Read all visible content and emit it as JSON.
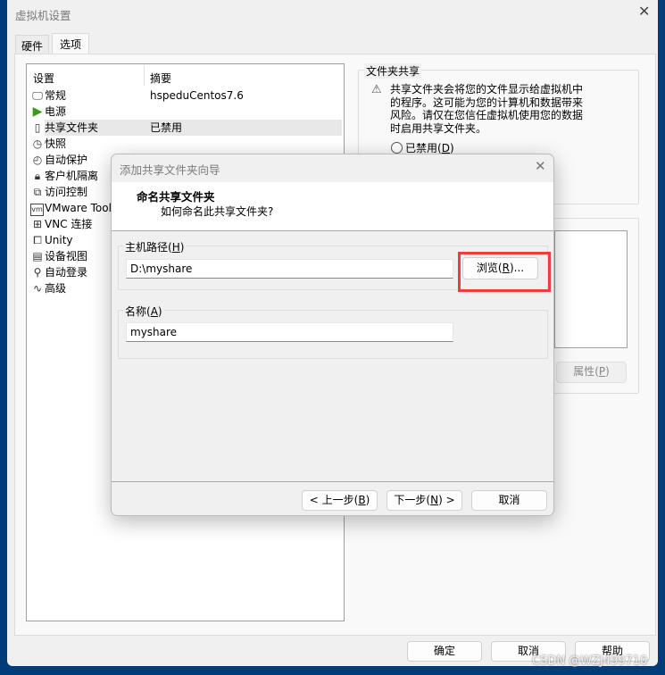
{
  "window": {
    "title": "虚拟机设置",
    "close_icon": "close-icon"
  },
  "tabs": [
    {
      "label": "硬件"
    },
    {
      "label": "选项",
      "selected": true
    }
  ],
  "settings_list": {
    "headers": [
      "设置",
      "摘要"
    ],
    "items": [
      {
        "icon": "monitor-icon",
        "glyph": "🖵",
        "label": "常规",
        "summary": "hspeduCentos7.6"
      },
      {
        "icon": "power-play-icon",
        "glyph": "▶",
        "label": "电源",
        "summary": ""
      },
      {
        "icon": "shared-folder-icon",
        "glyph": "▯",
        "label": "共享文件夹",
        "summary": "已禁用",
        "selected": true
      },
      {
        "icon": "snapshot-icon",
        "glyph": "◷",
        "label": "快照",
        "summary": ""
      },
      {
        "icon": "autoprotect-icon",
        "glyph": "◴",
        "label": "自动保护",
        "summary": ""
      },
      {
        "icon": "lock-icon",
        "glyph": "🔒︎",
        "label": "客户机隔离",
        "summary": ""
      },
      {
        "icon": "access-control-icon",
        "glyph": "⧉",
        "label": "访问控制",
        "summary": ""
      },
      {
        "icon": "vm-icon",
        "glyph": "vm",
        "label": "VMware Tools",
        "summary": ""
      },
      {
        "icon": "vnc-icon",
        "glyph": "⊞",
        "label": "VNC 连接",
        "summary": ""
      },
      {
        "icon": "unity-icon",
        "glyph": "⧠",
        "label": "Unity",
        "summary": ""
      },
      {
        "icon": "device-view-icon",
        "glyph": "▤",
        "label": "设备视图",
        "summary": ""
      },
      {
        "icon": "autologin-icon",
        "glyph": "⚲",
        "label": "自动登录",
        "summary": ""
      },
      {
        "icon": "advanced-icon",
        "glyph": "∿",
        "label": "高级",
        "summary": ""
      }
    ]
  },
  "folder_sharing": {
    "title": "文件夹共享",
    "warning_lines": [
      "共享文件夹会将您的文件显示给虚拟机中",
      "的程序。这可能为您的计算机和数据带来",
      "风险。请仅在您信任虚拟机使用您的数据",
      "时启用共享文件夹。"
    ],
    "radio_disabled": {
      "label": "已禁用",
      "key": "D",
      "checked": false
    },
    "properties_button": {
      "label": "属性",
      "key": "P"
    }
  },
  "footer": {
    "ok": "确定",
    "cancel": "取消",
    "help": "帮助"
  },
  "wizard": {
    "title": "添加共享文件夹向导",
    "heading": "命名共享文件夹",
    "subheading": "如何命名此共享文件夹?",
    "host_path": {
      "label": "主机路径",
      "key": "H",
      "value": "D:\\myshare"
    },
    "browse": {
      "label": "浏览",
      "key": "R",
      "suffix": "..."
    },
    "name": {
      "label": "名称",
      "key": "A",
      "value": "myshare"
    },
    "back": {
      "prefix": "< ",
      "label": "上一步",
      "key": "B"
    },
    "next": {
      "label": "下一步",
      "key": "N",
      "suffix": " >"
    },
    "cancel": "取消",
    "highlight_color": "#f03c3c"
  },
  "watermark": "CSDN @WZJ499710"
}
